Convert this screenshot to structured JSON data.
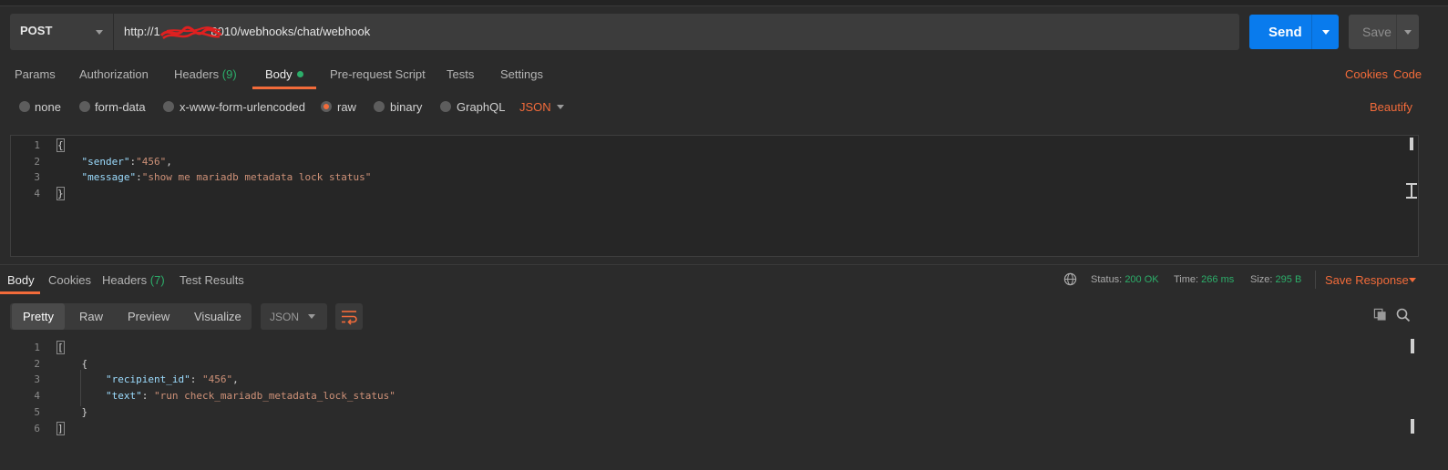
{
  "request": {
    "method": "POST",
    "url": "http://1        :8010/webhooks/chat/webhook",
    "send_label": "Send",
    "save_label": "Save"
  },
  "request_tabs": [
    {
      "label": "Params"
    },
    {
      "label": "Authorization"
    },
    {
      "label": "Headers",
      "count": "(9)"
    },
    {
      "label": "Body"
    },
    {
      "label": "Pre-request Script"
    },
    {
      "label": "Tests"
    },
    {
      "label": "Settings"
    }
  ],
  "request_links": {
    "cookies": "Cookies",
    "code": "Code"
  },
  "body_modes": [
    "none",
    "form-data",
    "x-www-form-urlencoded",
    "raw",
    "binary",
    "GraphQL"
  ],
  "body_format": "JSON",
  "beautify_label": "Beautify",
  "request_body": {
    "line_numbers": [
      "1",
      "2",
      "3",
      "4"
    ],
    "lines": {
      "l1": "{",
      "l2_key": "\"sender\"",
      "l2_val": "\"456\"",
      "l3_key": "\"message\"",
      "l3_val": "\"show me mariadb metadata lock status\"",
      "l4": "}"
    }
  },
  "response_tabs": [
    {
      "label": "Body"
    },
    {
      "label": "Cookies"
    },
    {
      "label": "Headers",
      "count": "(7)"
    },
    {
      "label": "Test Results"
    }
  ],
  "response_meta": {
    "status_label": "Status:",
    "status_value": "200 OK",
    "time_label": "Time:",
    "time_value": "266 ms",
    "size_label": "Size:",
    "size_value": "295 B",
    "save_response": "Save Response"
  },
  "view_modes": [
    "Pretty",
    "Raw",
    "Preview",
    "Visualize"
  ],
  "response_format": "JSON",
  "response_body": {
    "line_numbers": [
      "1",
      "2",
      "3",
      "4",
      "5",
      "6"
    ],
    "lines": {
      "l1": "[",
      "l2": "{",
      "l3_key": "\"recipient_id\"",
      "l3_val": "\"456\"",
      "l4_key": "\"text\"",
      "l4_val": "\"run check_mariadb_metadata_lock_status\"",
      "l5": "}",
      "l6": "]"
    }
  },
  "colors": {
    "accent": "#f26b3a",
    "primary": "#097bed",
    "success": "#2cae6a"
  }
}
